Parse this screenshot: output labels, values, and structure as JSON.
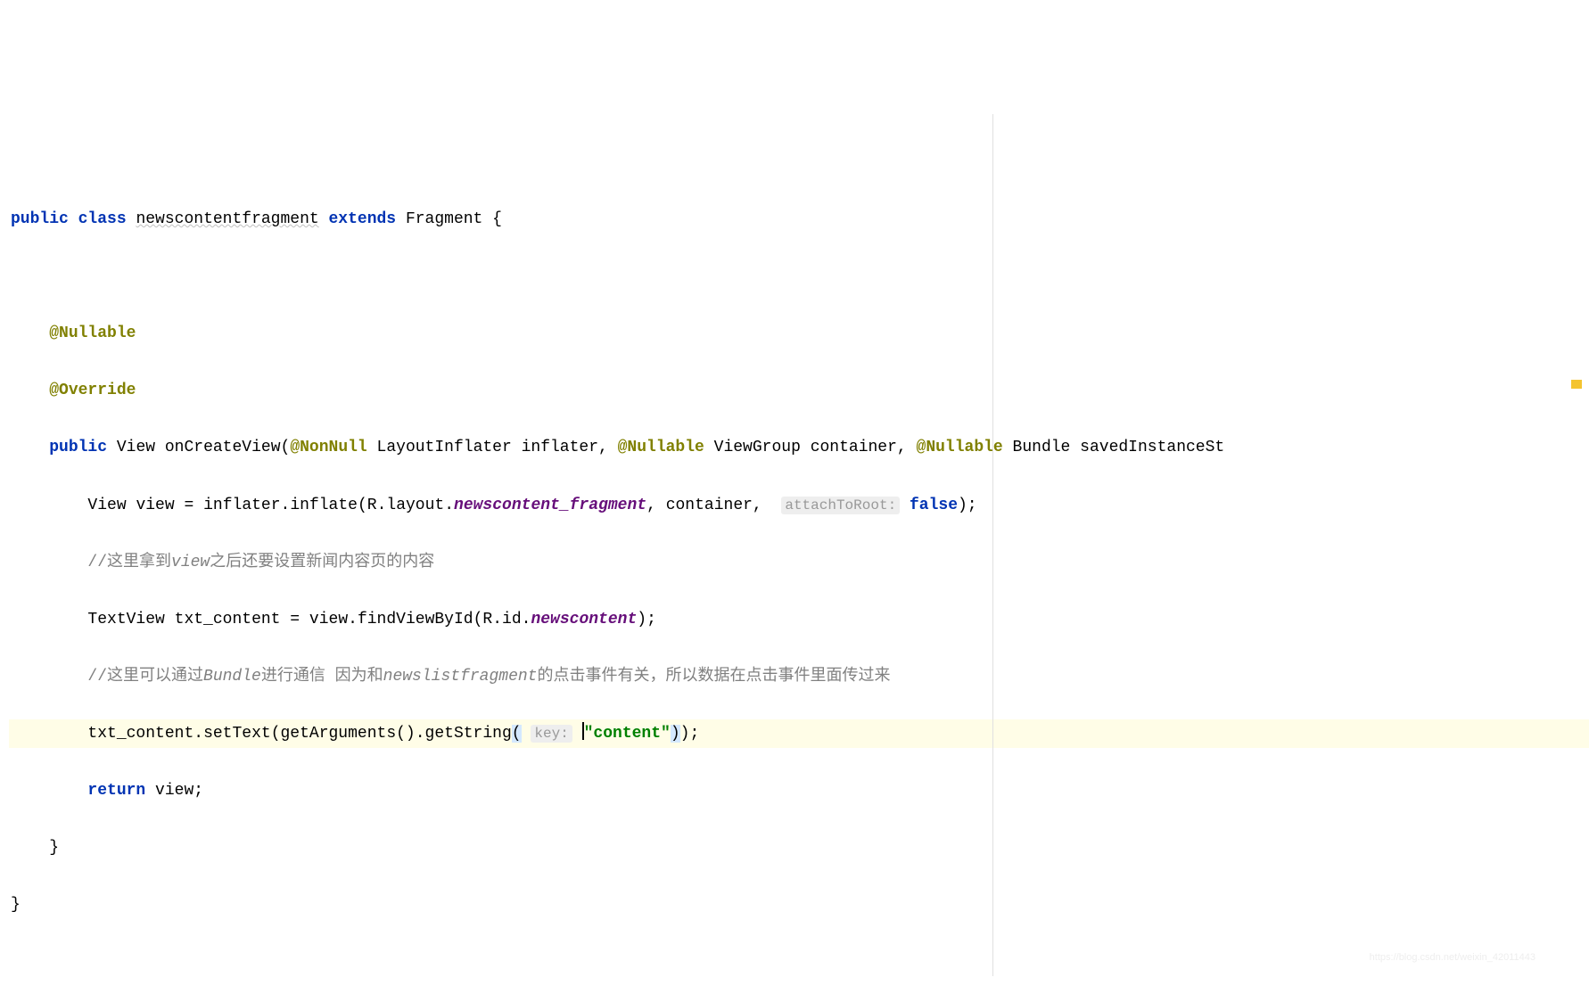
{
  "code": {
    "l1": {
      "kw_public": "public",
      "kw_class": "class",
      "classname": "newscontentfragment",
      "kw_extends": "extends",
      "superclass": "Fragment",
      "brace": "{"
    },
    "l3": {
      "annotation": "@Nullable"
    },
    "l4": {
      "annotation": "@Override"
    },
    "l5": {
      "kw_public": "public",
      "ret_type": "View",
      "method": "onCreateView",
      "p1_ann": "@NonNull",
      "p1_type": "LayoutInflater",
      "p1_name": "inflater",
      "p2_ann": "@Nullable",
      "p2_type": "ViewGroup",
      "p2_name": "container",
      "p3_ann": "@Nullable",
      "p3_type": "Bundle",
      "p3_name": "savedInstanceSt"
    },
    "l6": {
      "type": "View",
      "var": "view",
      "eq": "=",
      "obj": "inflater",
      "dot1": ".",
      "m1": "inflate",
      "par_open": "(",
      "r": "R",
      "dot2": ".",
      "layout": "layout",
      "dot3": ".",
      "resource": "newscontent_fragment",
      "comma1": ",",
      "arg2": "container",
      "comma2": ",",
      "hint": "attachToRoot:",
      "val": "false",
      "close": ");"
    },
    "l7": {
      "comment_prefix": "//这里拿到",
      "comment_italic": "view",
      "comment_suffix": "之后还要设置新闻内容页的内容"
    },
    "l8": {
      "type": "TextView",
      "var": "txt_content",
      "eq": "=",
      "obj": "view",
      "dot1": ".",
      "m1": "findViewById",
      "par_open": "(",
      "r": "R",
      "dot2": ".",
      "id": "id",
      "dot3": ".",
      "resource": "newscontent",
      "close": ");"
    },
    "l9": {
      "comment_prefix": "//这里可以通过",
      "comment_italic1": "Bundle",
      "comment_mid": "进行通信 因为和",
      "comment_italic2": "newslistfragment",
      "comment_suffix": "的点击事件有关，所以数据在点击事件里面传过来"
    },
    "l10": {
      "obj": "txt_content",
      "dot1": ".",
      "m1": "setText",
      "par_open1": "(",
      "m2": "getArguments",
      "par2": "()",
      "dot2": ".",
      "m3": "getString",
      "par_open3": "(",
      "hint": "key:",
      "string": "\"content\"",
      "close": "));"
    },
    "l11": {
      "kw_return": "return",
      "var": "view",
      "semi": ";"
    },
    "l12": {
      "brace": "}"
    },
    "l13": {
      "brace": "}"
    }
  },
  "watermark": "https://blog.csdn.net/weixin_42011443"
}
